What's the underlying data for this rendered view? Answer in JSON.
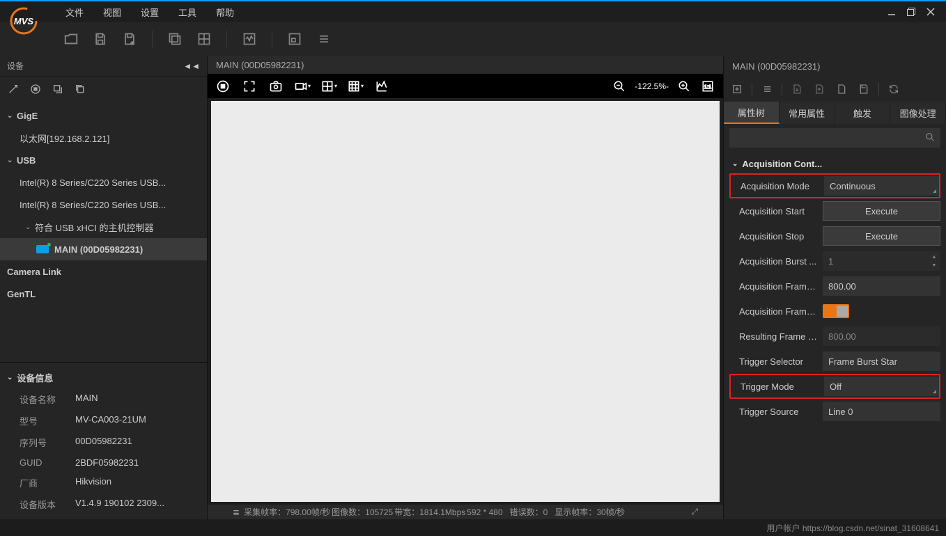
{
  "menu": {
    "file": "文件",
    "view": "视图",
    "settings": "设置",
    "tools": "工具",
    "help": "帮助"
  },
  "sidebar": {
    "title": "设备",
    "gige": "GigE",
    "ethernet": "以太网[192.168.2.121]",
    "usb": "USB",
    "usb1": "Intel(R) 8 Series/C220 Series USB...",
    "usb2": "Intel(R) 8 Series/C220 Series USB...",
    "xhci": "符合 USB xHCI 的主机控制器",
    "main_cam": "MAIN (00D05982231)",
    "camlink": "Camera Link",
    "gentl": "GenTL"
  },
  "devinfo": {
    "title": "设备信息",
    "rows": [
      {
        "k": "设备名称",
        "v": "MAIN"
      },
      {
        "k": "型号",
        "v": "MV-CA003-21UM"
      },
      {
        "k": "序列号",
        "v": "00D05982231"
      },
      {
        "k": "GUID",
        "v": "2BDF05982231"
      },
      {
        "k": "厂商",
        "v": "Hikvision"
      },
      {
        "k": "设备版本",
        "v": "V1.4.9 190102 2309..."
      }
    ]
  },
  "center": {
    "title": "MAIN (00D05982231)",
    "zoom": "-122.5%-"
  },
  "status": {
    "s1_lbl": "采集帧率：",
    "s1_val": "798.00帧/秒",
    "s2_lbl": "图像数：",
    "s2_val": "105725",
    "s3_lbl": "带宽：",
    "s3_val": "1814.1Mbps",
    "s4_val": "592 * 480",
    "s5_lbl": "错误数：",
    "s5_val": "0",
    "s6_lbl": "显示帧率：",
    "s6_val": "30帧/秒"
  },
  "right": {
    "title": "MAIN (00D05982231)",
    "tabs": {
      "tree": "属性树",
      "common": "常用属性",
      "trigger": "触发",
      "image": "图像处理"
    },
    "section": "Acquisition Cont...",
    "rows": {
      "acq_mode_lbl": "Acquisition Mode",
      "acq_mode_val": "Continuous",
      "acq_start_lbl": "Acquisition Start",
      "execute": "Execute",
      "acq_stop_lbl": "Acquisition Stop",
      "burst_lbl": "Acquisition Burst ...",
      "burst_val": "1",
      "framerate_lbl": "Acquisition Frame...",
      "framerate_val": "800.00",
      "frameen_lbl": "Acquisition Frame...",
      "result_lbl": "Resulting Frame R...",
      "result_val": "800.00",
      "trigsel_lbl": "Trigger Selector",
      "trigsel_val": "Frame Burst Star",
      "trigmode_lbl": "Trigger Mode",
      "trigmode_val": "Off",
      "trigsrc_lbl": "Trigger Source",
      "trigsrc_val": "Line 0"
    }
  },
  "footer": {
    "left": "用户帐户",
    "url": "https://blog.csdn.net/sinat_31608641"
  }
}
